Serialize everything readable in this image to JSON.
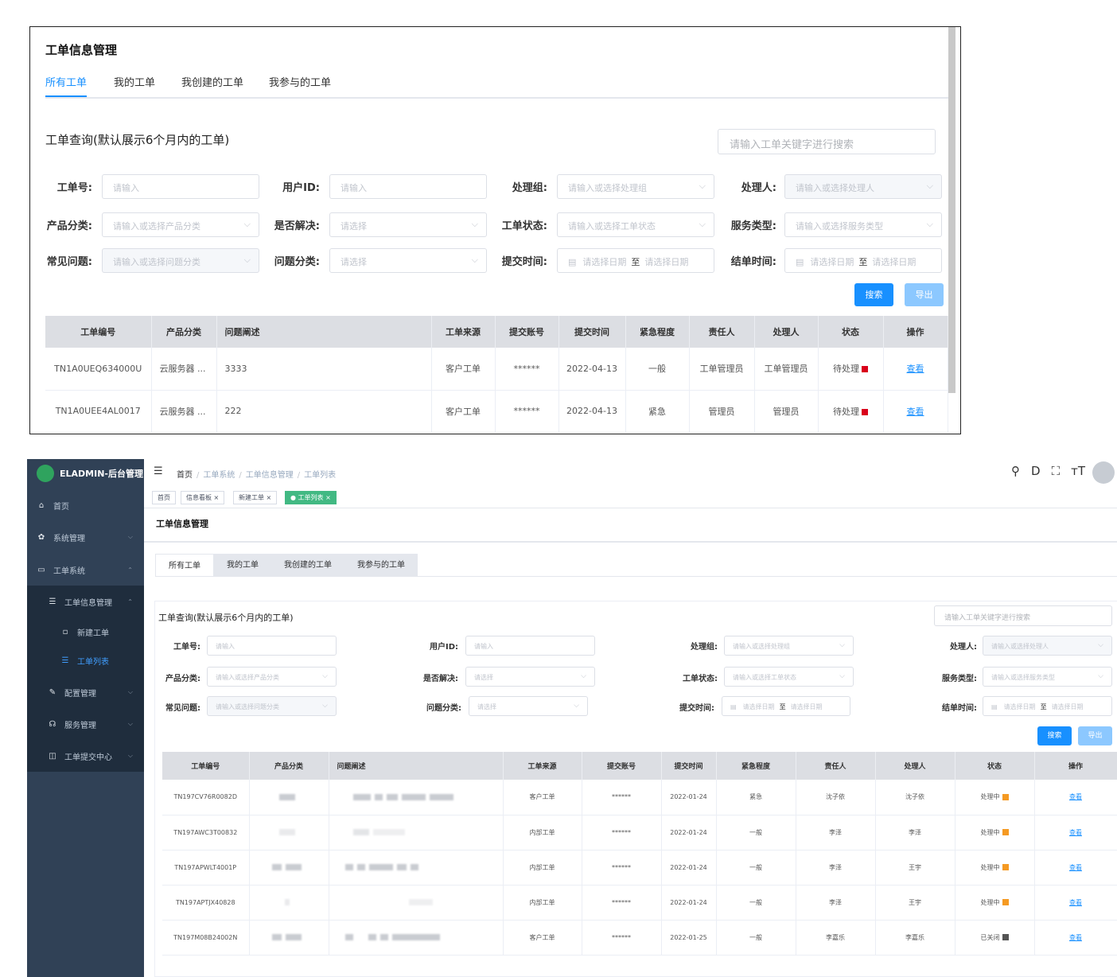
{
  "shot1": {
    "title": "工单信息管理",
    "tabs": [
      "所有工单",
      "我的工单",
      "我创建的工单",
      "我参与的工单"
    ],
    "query_title": "工单查询(默认展示6个月内的工单)",
    "keyword_placeholder": "请输入工单关键字进行搜索",
    "fields": [
      {
        "label": "工单号:",
        "placeholder": "请输入"
      },
      {
        "label": "用户ID:",
        "placeholder": "请输入"
      },
      {
        "label": "处理组:",
        "placeholder": "请输入或选择处理组"
      },
      {
        "label": "处理人:",
        "placeholder": "请输入或选择处理人"
      },
      {
        "label": "产品分类:",
        "placeholder": "请输入或选择产品分类"
      },
      {
        "label": "是否解决:",
        "placeholder": "请选择"
      },
      {
        "label": "工单状态:",
        "placeholder": "请输入或选择工单状态"
      },
      {
        "label": "服务类型:",
        "placeholder": "请输入或选择服务类型"
      },
      {
        "label": "常见问题:",
        "placeholder": "请输入或选择问题分类"
      },
      {
        "label": "问题分类:",
        "placeholder": "请选择"
      },
      {
        "label": "提交时间:",
        "date_start": "请选择日期",
        "date_sep": "至",
        "date_end": "请选择日期"
      },
      {
        "label": "结单时间:",
        "date_start": "请选择日期",
        "date_sep": "至",
        "date_end": "请选择日期"
      }
    ],
    "search_label": "搜索",
    "export_label": "导出",
    "columns": [
      "工单编号",
      "产品分类",
      "问题阐述",
      "工单来源",
      "提交账号",
      "提交时间",
      "紧急程度",
      "责任人",
      "处理人",
      "状态",
      "操作"
    ],
    "rows": [
      {
        "id": "TN1A0UEQ634000U",
        "product": "云服务器 ...",
        "desc": "3333",
        "source": "客户工单",
        "account": "******",
        "time": "2022-04-13",
        "urgency": "一般",
        "owner": "工单管理员",
        "handler": "工单管理员",
        "status": "待处理",
        "status_color": "#d9001b",
        "action": "查看"
      },
      {
        "id": "TN1A0UEE4AL0017",
        "product": "云服务器 ...",
        "desc": "222",
        "source": "客户工单",
        "account": "******",
        "time": "2022-04-13",
        "urgency": "紧急",
        "owner": "管理员",
        "handler": "管理员",
        "status": "待处理",
        "status_color": "#d9001b",
        "action": "查看"
      }
    ]
  },
  "shot2": {
    "app_name": "ELADMIN-后台管理",
    "menu": [
      {
        "label": "首页",
        "icon": "dashboard-icon"
      },
      {
        "label": "系统管理",
        "icon": "gear-icon"
      },
      {
        "label": "工单系统",
        "icon": "document-icon"
      },
      {
        "label": "工单信息管理",
        "icon": "list-icon"
      },
      {
        "label": "新建工单",
        "icon": "form-icon"
      },
      {
        "label": "工单列表",
        "icon": "list-icon"
      },
      {
        "label": "配置管理",
        "icon": "edit-icon"
      },
      {
        "label": "服务管理",
        "icon": "chat-icon"
      },
      {
        "label": "工单提交中心",
        "icon": "window-icon"
      }
    ],
    "breadcrumb": [
      "首页",
      "工单系统",
      "工单信息管理",
      "工单列表"
    ],
    "tags": [
      "首页",
      "信息看板",
      "新建工单",
      "工单列表"
    ],
    "title": "工单信息管理",
    "tabs": [
      "所有工单",
      "我的工单",
      "我创建的工单",
      "我参与的工单"
    ],
    "query_title": "工单查询(默认展示6个月内的工单)",
    "keyword_placeholder": "请输入工单关键字进行搜索",
    "fields": [
      {
        "label": "工单号:",
        "placeholder": "请输入"
      },
      {
        "label": "用户ID:",
        "placeholder": "请输入"
      },
      {
        "label": "处理组:",
        "placeholder": "请输入或选择处理组"
      },
      {
        "label": "处理人:",
        "placeholder": "请输入或选择处理人"
      },
      {
        "label": "产品分类:",
        "placeholder": "请输入或选择产品分类"
      },
      {
        "label": "是否解决:",
        "placeholder": "请选择"
      },
      {
        "label": "工单状态:",
        "placeholder": "请输入或选择工单状态"
      },
      {
        "label": "服务类型:",
        "placeholder": "请输入或选择服务类型"
      },
      {
        "label": "常见问题:",
        "placeholder": "请输入或选择问题分类"
      },
      {
        "label": "问题分类:",
        "placeholder": "请选择"
      },
      {
        "label": "提交时间:",
        "date_start": "请选择日期",
        "date_sep": "至",
        "date_end": "请选择日期"
      },
      {
        "label": "结单时间:",
        "date_start": "请选择日期",
        "date_sep": "至",
        "date_end": "请选择日期"
      }
    ],
    "search_label": "搜索",
    "export_label": "导出",
    "columns": [
      "工单编号",
      "产品分类",
      "问题阐述",
      "工单来源",
      "提交账号",
      "提交时间",
      "紧急程度",
      "责任人",
      "处理人",
      "状态",
      "操作"
    ],
    "rows": [
      {
        "id": "TN197CV76R0082D",
        "source": "客户工单",
        "account": "******",
        "time": "2022-01-24",
        "urgency": "紧急",
        "owner": "沈子依",
        "handler": "沈子依",
        "status": "处理中",
        "status_color": "#f59a23",
        "action": "查看"
      },
      {
        "id": "TN197AWC3T00832",
        "source": "内部工单",
        "account": "******",
        "time": "2022-01-24",
        "urgency": "一般",
        "owner": "李泽",
        "handler": "李泽",
        "status": "处理中",
        "status_color": "#f59a23",
        "action": "查看"
      },
      {
        "id": "TN197APWLT4001P",
        "source": "内部工单",
        "account": "******",
        "time": "2022-01-24",
        "urgency": "一般",
        "owner": "李泽",
        "handler": "王宇",
        "status": "处理中",
        "status_color": "#f59a23",
        "action": "查看"
      },
      {
        "id": "TN197APTJX40828",
        "source": "内部工单",
        "account": "******",
        "time": "2022-01-24",
        "urgency": "一般",
        "owner": "李泽",
        "handler": "王宇",
        "status": "处理中",
        "status_color": "#f59a23",
        "action": "查看"
      },
      {
        "id": "TN197M08B24002N",
        "source": "客户工单",
        "account": "******",
        "time": "2022-01-25",
        "urgency": "一般",
        "owner": "李嘉乐",
        "handler": "李嘉乐",
        "status": "已关闭",
        "status_color": "#555555",
        "action": "查看"
      }
    ]
  }
}
